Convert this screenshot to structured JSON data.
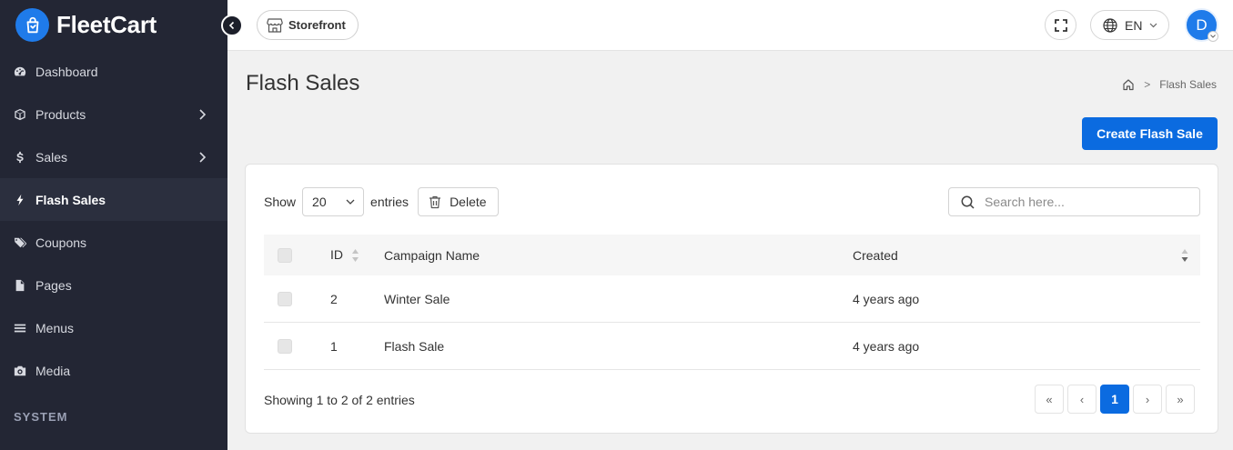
{
  "brand": {
    "name": "FleetCart"
  },
  "sidebar": {
    "items": [
      {
        "label": "Dashboard",
        "icon": "dashboard-icon",
        "has_children": false,
        "active": false
      },
      {
        "label": "Products",
        "icon": "cube-icon",
        "has_children": true,
        "active": false
      },
      {
        "label": "Sales",
        "icon": "dollar-icon",
        "has_children": true,
        "active": false
      },
      {
        "label": "Flash Sales",
        "icon": "bolt-icon",
        "has_children": false,
        "active": true
      },
      {
        "label": "Coupons",
        "icon": "tags-icon",
        "has_children": false,
        "active": false
      },
      {
        "label": "Pages",
        "icon": "file-icon",
        "has_children": false,
        "active": false
      },
      {
        "label": "Menus",
        "icon": "bars-icon",
        "has_children": false,
        "active": false
      },
      {
        "label": "Media",
        "icon": "camera-icon",
        "has_children": false,
        "active": false
      }
    ],
    "section_label": "SYSTEM"
  },
  "header": {
    "storefront_label": "Storefront",
    "language": "EN",
    "avatar_initial": "D"
  },
  "page": {
    "title": "Flash Sales",
    "breadcrumb_current": "Flash Sales",
    "create_button": "Create Flash Sale"
  },
  "toolbar": {
    "show_label": "Show",
    "entries_value": "20",
    "entries_label": "entries",
    "delete_label": "Delete",
    "search_placeholder": "Search here..."
  },
  "table": {
    "columns": [
      "ID",
      "Campaign Name",
      "Created"
    ],
    "rows": [
      {
        "id": "2",
        "name": "Winter Sale",
        "created": "4 years ago"
      },
      {
        "id": "1",
        "name": "Flash Sale",
        "created": "4 years ago"
      }
    ]
  },
  "footer": {
    "showing": "Showing 1 to 2 of 2 entries",
    "pages": {
      "first": "«",
      "prev": "‹",
      "current": "1",
      "next": "›",
      "last": "»"
    }
  },
  "colors": {
    "sidebar_bg": "#232634",
    "accent": "#0b6be0",
    "page_bg": "#f1f1f1"
  }
}
